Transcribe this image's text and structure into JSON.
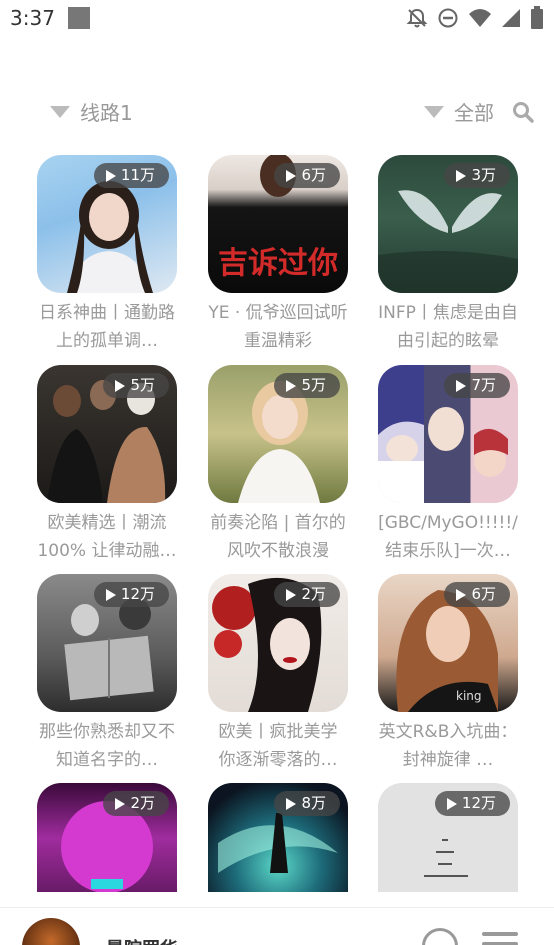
{
  "status": {
    "time": "3:37",
    "icons": [
      "notification-square-icon",
      "bell-off-icon",
      "do-not-disturb-icon",
      "wifi-icon",
      "signal-icon",
      "battery-icon"
    ]
  },
  "filters": {
    "route_label": "线路1",
    "category_label": "全部"
  },
  "playlists": [
    {
      "plays": "11万",
      "title": "日系神曲丨通勤路上的孤单调…"
    },
    {
      "plays": "6万",
      "title": "YE · 侃爷巡回试听 重温精彩"
    },
    {
      "plays": "3万",
      "title": "INFP丨焦虑是由自由引起的眩晕"
    },
    {
      "plays": "5万",
      "title": "欧美精选丨潮流100% 让律动融…"
    },
    {
      "plays": "5万",
      "title": "前奏沦陷 | 首尔的风吹不散浪漫"
    },
    {
      "plays": "7万",
      "title": "[GBC/MyGO!!!!!/结束乐队]一次…"
    },
    {
      "plays": "12万",
      "title": "那些你熟悉却又不知道名字的…"
    },
    {
      "plays": "2万",
      "title": "欧美丨疯批美学 你逐渐零落的…"
    },
    {
      "plays": "6万",
      "title": "英文R&B入坑曲：封神旋律 …"
    },
    {
      "plays": "2万",
      "title": ""
    },
    {
      "plays": "8万",
      "title": ""
    },
    {
      "plays": "12万",
      "title": ""
    }
  ],
  "cover_art": {
    "c1_text": "吉诉过你",
    "c2_text": "king"
  },
  "player": {
    "title": "暑院罢华"
  },
  "colors": {
    "accent_gray": "#999999",
    "badge_bg": "#464646"
  }
}
